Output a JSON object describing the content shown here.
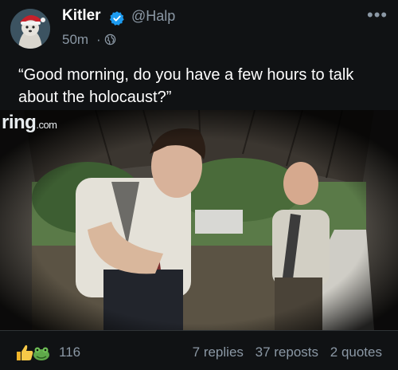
{
  "post": {
    "author_name": "Kitler",
    "handle": "@Halp",
    "time": "50m",
    "separator": "·",
    "text": "“Good morning, do you have a few hours to talk about the holocaust?”",
    "more_label": "•••",
    "verified": true
  },
  "media": {
    "logo_main": "ring",
    "logo_suffix": ".com"
  },
  "footer": {
    "reaction_icons": [
      "thumbs-up-icon",
      "frog-icon"
    ],
    "like_count": "116",
    "replies": "7 replies",
    "reposts": "37 reposts",
    "quotes": "2 quotes"
  },
  "colors": {
    "background": "#101214",
    "muted": "#8b98a5",
    "verified_blue": "#1d9bf0"
  }
}
